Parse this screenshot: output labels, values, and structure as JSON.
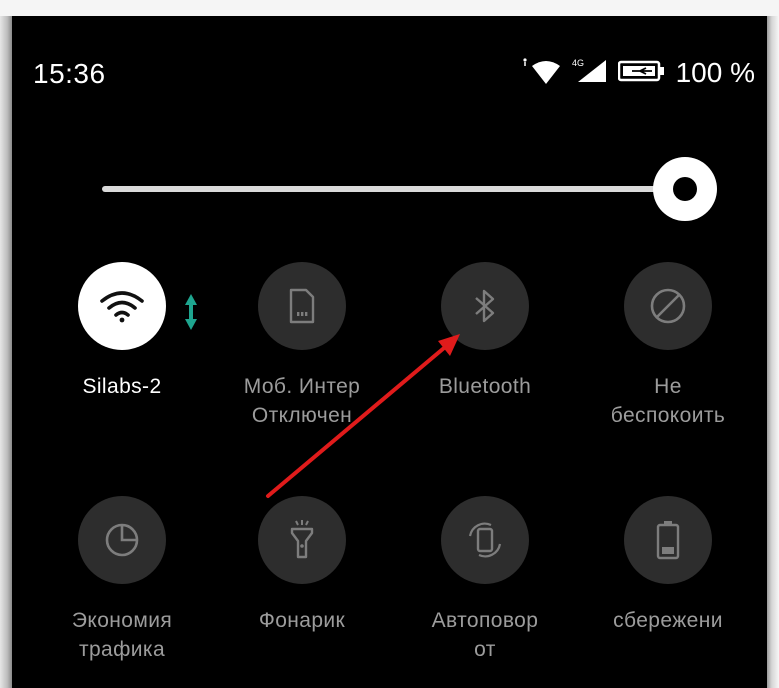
{
  "status_bar": {
    "time": "15:36",
    "battery_percent": "100 %",
    "network_label": "4G"
  },
  "brightness": {
    "level": 0.94
  },
  "tiles": {
    "wifi": {
      "label": "Silabs-2",
      "active": true,
      "icon": "wifi-icon"
    },
    "mobile_data": {
      "label": "Моб. Интер\nОтключен",
      "active": false,
      "icon": "sim-card-icon"
    },
    "bluetooth": {
      "label": "Bluetooth",
      "active": false,
      "icon": "bluetooth-icon"
    },
    "dnd": {
      "label": "Не\nбеспокоить",
      "active": false,
      "icon": "do-not-disturb-icon"
    },
    "data_saver": {
      "label": "Экономия\nтрафика",
      "active": false,
      "icon": "pie-chart-icon"
    },
    "flashlight": {
      "label": "Фонарик",
      "active": false,
      "icon": "flashlight-icon"
    },
    "autorotate": {
      "label": "Автоповор\nот",
      "active": false,
      "icon": "rotate-icon"
    },
    "battery_saver": {
      "label": "сбережени",
      "active": false,
      "icon": "battery-icon"
    }
  },
  "colors": {
    "active_tile": "#ffffff",
    "inactive_tile": "#2d2d2d",
    "accent_arrows": "#1ea58f",
    "annotation_arrow": "#e01b1b"
  }
}
